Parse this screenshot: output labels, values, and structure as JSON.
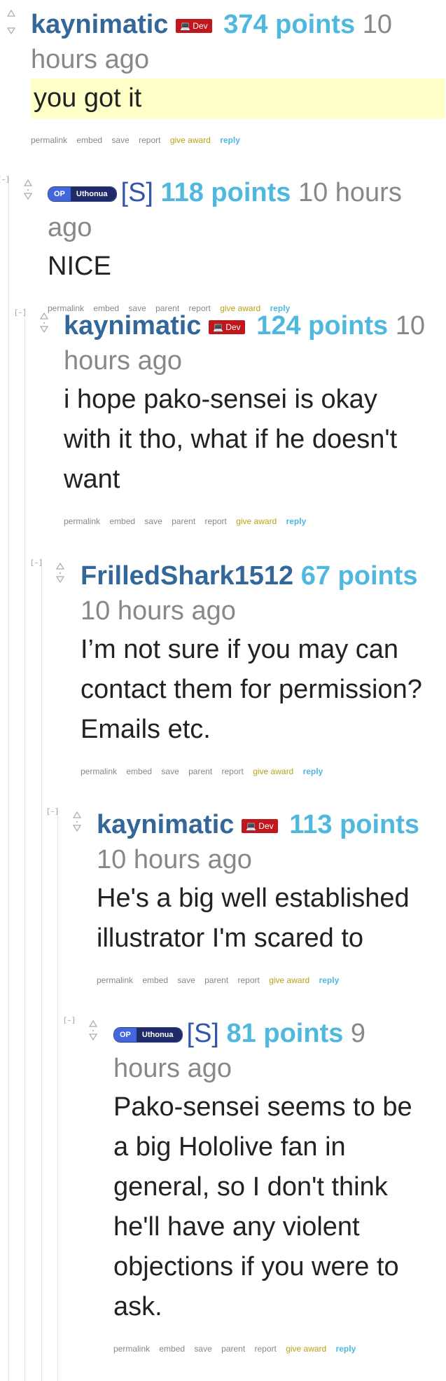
{
  "comments": [
    {
      "author": "kaynimatic",
      "dev_badge": "💻 Dev",
      "score": "374 points",
      "time": "10 hours ago",
      "body": "you got it",
      "collapse": "[–]",
      "links": [
        "permalink",
        "embed",
        "save",
        "report"
      ],
      "award": "give award",
      "reply": "reply"
    },
    {
      "op_label": "OP",
      "flair": "Uthonua",
      "sub": "[S]",
      "score": "118 points",
      "time": "10 hours ago",
      "body": "NICE",
      "collapse": "[–]",
      "links": [
        "permalink",
        "embed",
        "save",
        "parent",
        "report"
      ],
      "award": "give award",
      "reply": "reply"
    },
    {
      "author": "kaynimatic",
      "dev_badge": "💻 Dev",
      "score": "124 points",
      "time": "10 hours ago",
      "body": "i hope pako-sensei is okay with it tho, what if he doesn't want",
      "collapse": "[–]",
      "links": [
        "permalink",
        "embed",
        "save",
        "parent",
        "report"
      ],
      "award": "give award",
      "reply": "reply"
    },
    {
      "author": "FrilledShark1512",
      "score": "67 points",
      "time": "10 hours ago",
      "body": "I’m not sure if you may can contact them for permission? Emails etc.",
      "collapse": "[–]",
      "links": [
        "permalink",
        "embed",
        "save",
        "parent",
        "report"
      ],
      "award": "give award",
      "reply": "reply"
    },
    {
      "author": "kaynimatic",
      "dev_badge": "💻 Dev",
      "score": "113 points",
      "time": "10 hours ago",
      "body": "He's a big well established illustrator I'm scared to",
      "collapse": "[–]",
      "links": [
        "permalink",
        "embed",
        "save",
        "parent",
        "report"
      ],
      "award": "give award",
      "reply": "reply"
    },
    {
      "op_label": "OP",
      "flair": "Uthonua",
      "sub": "[S]",
      "score": "81 points",
      "time": "9 hours ago",
      "body": "Pako-sensei seems to be a big Hololive fan in general, so I don't think he'll have any violent objections if you were to ask.",
      "collapse": "[–]",
      "links": [
        "permalink",
        "embed",
        "save",
        "parent",
        "report"
      ],
      "award": "give award",
      "reply": "reply"
    }
  ],
  "icons": {
    "upvote": "upvote-arrow-icon",
    "downvote": "downvote-arrow-icon"
  },
  "colors": {
    "author": "#336699",
    "score": "#4fb8de",
    "dev_badge": "#c0161c",
    "op_badge": "#4466dd",
    "flair": "#1f2a66",
    "highlight": "#ffffc8",
    "award": "#b8a216"
  }
}
